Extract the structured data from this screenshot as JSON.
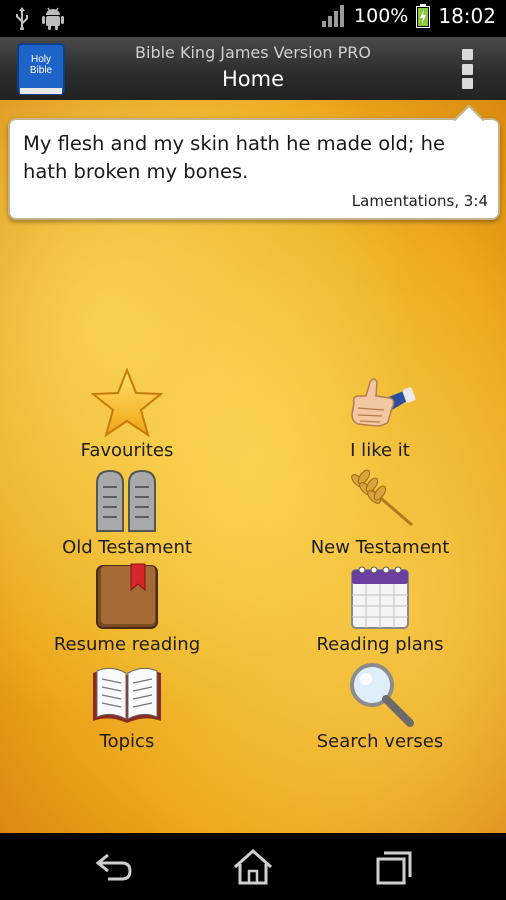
{
  "status_bar": {
    "battery_percent": "100%",
    "time": "18:02",
    "icons": [
      "usb-icon",
      "android-debug-icon",
      "signal-icon",
      "battery-charging-icon"
    ]
  },
  "action_bar": {
    "app_icon_text_line1": "Holy",
    "app_icon_text_line2": "Bible",
    "subtitle": "Bible King James Version PRO",
    "title": "Home",
    "menu_icon": "overflow-menu-icon"
  },
  "verse": {
    "text": "My flesh and my skin hath he made old; he hath broken my bones.",
    "reference": "Lamentations, 3:4"
  },
  "menu": [
    {
      "label": "Favourites",
      "icon": "star-icon"
    },
    {
      "label": "I like it",
      "icon": "thumbs-up-icon"
    },
    {
      "label": "Old Testament",
      "icon": "stone-tablets-icon"
    },
    {
      "label": "New Testament",
      "icon": "wheat-icon"
    },
    {
      "label": "Resume reading",
      "icon": "bookmark-book-icon"
    },
    {
      "label": "Reading plans",
      "icon": "calendar-icon"
    },
    {
      "label": "Topics",
      "icon": "open-book-icon"
    },
    {
      "label": "Search verses",
      "icon": "magnifier-icon"
    }
  ],
  "nav_bar": [
    "back-icon",
    "home-icon",
    "recent-apps-icon"
  ],
  "colors": {
    "parchment": "#eba51b",
    "action_bar": "#2b2b2b",
    "card_border": "#c3b38a"
  }
}
